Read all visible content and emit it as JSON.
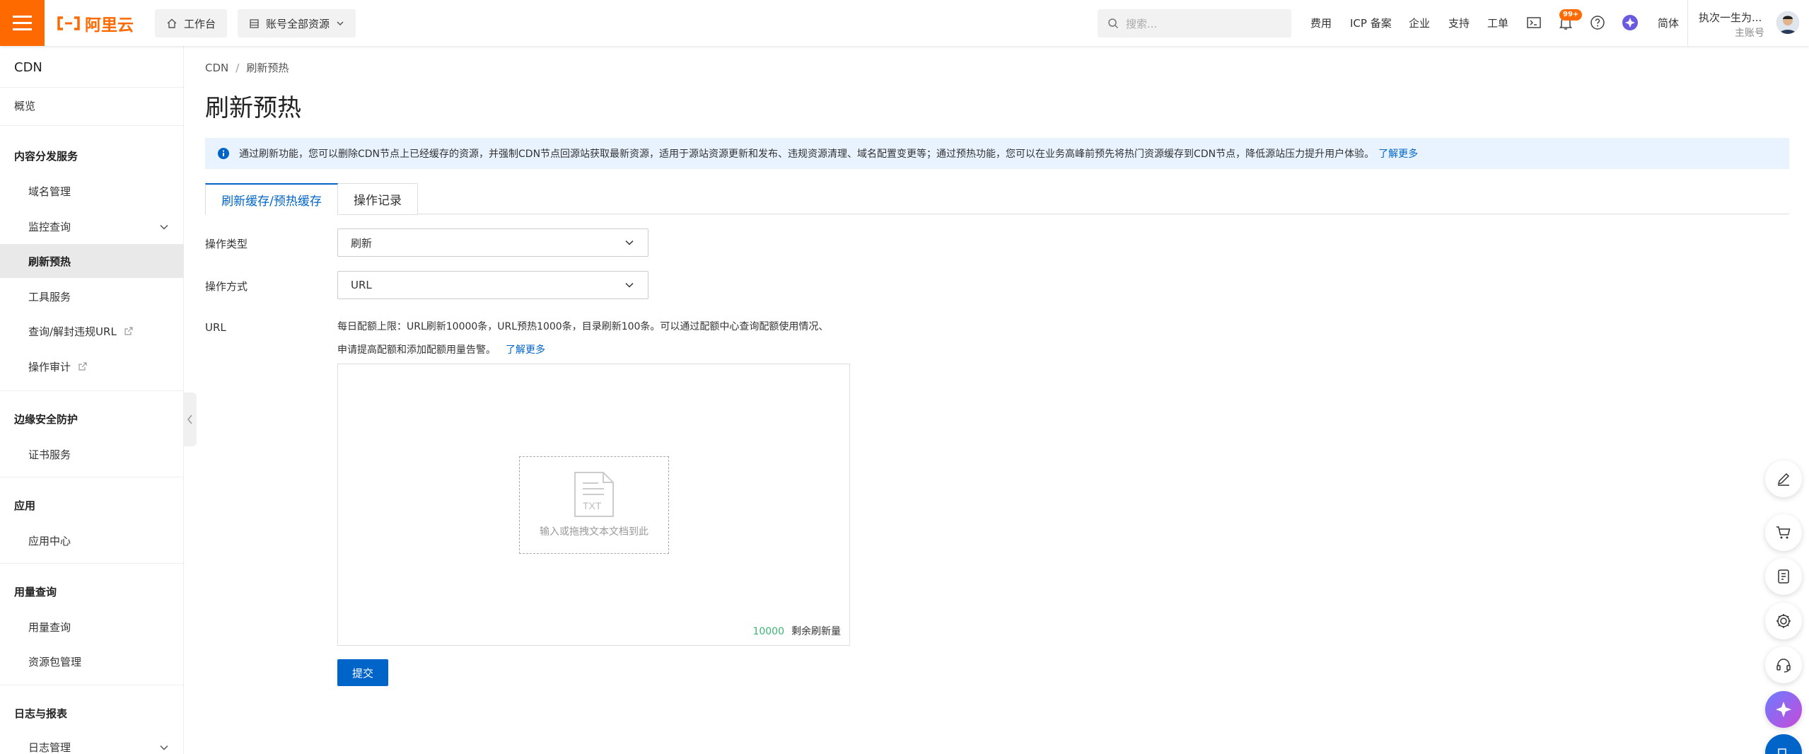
{
  "logo_text": "阿里云",
  "header": {
    "workbench": "工作台",
    "resources": "账号全部资源",
    "search_placeholder": "搜索...",
    "nav": [
      "费用",
      "ICP 备案",
      "企业",
      "支持",
      "工单"
    ],
    "message_badge": "99+",
    "language": "简体",
    "account_name": "执次一生为...",
    "account_role": "主账号"
  },
  "sidebar": {
    "title": "CDN",
    "overview": "概览",
    "groups": {
      "content": "内容分发服务",
      "edge": "边缘安全防护",
      "app": "应用",
      "usage": "用量查询",
      "logs": "日志与报表"
    },
    "items": {
      "domain": "域名管理",
      "monitor": "监控查询",
      "refresh": "刷新预热",
      "tools": "工具服务",
      "violation": "查询/解封违规URL",
      "audit": "操作审计",
      "cert": "证书服务",
      "app_center": "应用中心",
      "usage_query": "用量查询",
      "package": "资源包管理",
      "log_mgmt": "日志管理"
    }
  },
  "main": {
    "breadcrumb": [
      "CDN",
      "刷新预热"
    ],
    "title": "刷新预热",
    "notice": "通过刷新功能，您可以删除CDN节点上已经缓存的资源，并强制CDN节点回源站获取最新资源，适用于源站资源更新和发布、违规资源清理、域名配置变更等；通过预热功能，您可以在业务高峰前预先将热门资源缓存到CDN节点，降低源站压力提升用户体验。",
    "notice_link": "了解更多",
    "tabs": [
      "刷新缓存/预热缓存",
      "操作记录"
    ],
    "form": {
      "op_type_label": "操作类型",
      "op_type_value": "刷新",
      "op_mode_label": "操作方式",
      "op_mode_value": "URL",
      "url_label": "URL",
      "hint_line1": "每日配额上限：URL刷新10000条，URL预热1000条，目录刷新100条。可以通过配额中心查询配额使用情况、",
      "hint_line2": "申请提高配额和添加配额用量告警。",
      "hint_link": "了解更多",
      "file_icon_text": "TXT",
      "drop_text": "输入或拖拽文本文档到此",
      "remaining_count": "10000",
      "remaining_label": "剩余刷新量",
      "submit": "提交"
    }
  },
  "colors": {
    "brand": "#ff6a00",
    "primary": "#0064c8",
    "notice_bg": "#e8f3ff"
  }
}
